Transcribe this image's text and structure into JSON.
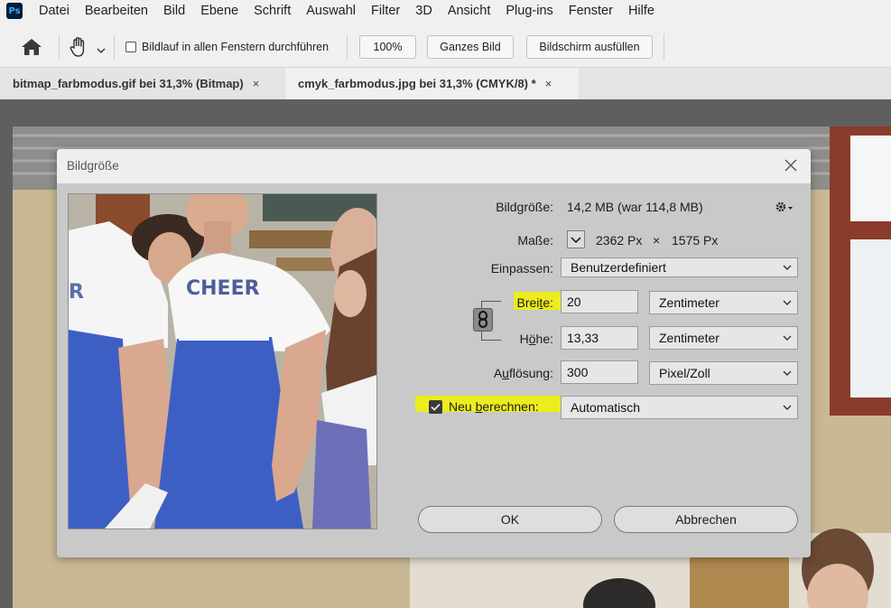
{
  "app": {
    "logo_text": "Ps"
  },
  "menu": [
    "Datei",
    "Bearbeiten",
    "Bild",
    "Ebene",
    "Schrift",
    "Auswahl",
    "Filter",
    "3D",
    "Ansicht",
    "Plug-ins",
    "Fenster",
    "Hilfe"
  ],
  "options": {
    "scroll_all_label": "Bildlauf in allen Fenstern durchführen",
    "zoom_100": "100%",
    "fit_screen": "Ganzes Bild",
    "fill_screen": "Bildschirm ausfüllen"
  },
  "tabs": [
    {
      "label": "bitmap_farbmodus.gif bei 31,3% (Bitmap)",
      "close": "×"
    },
    {
      "label": "cmyk_farbmodus.jpg bei 31,3% (CMYK/8) *",
      "close": "×"
    }
  ],
  "dialog": {
    "title": "Bildgröße",
    "image_size_label": "Bildgröße:",
    "image_size_value": "14,2 MB (war 114,8 MB)",
    "dimensions_label": "Maße:",
    "dimensions_width": "2362 Px",
    "dimensions_x": "×",
    "dimensions_height": "1575 Px",
    "fit_label": "Einpassen:",
    "fit_value": "Benutzerdefiniert",
    "width_label_pre": "Brei",
    "width_label_u": "t",
    "width_label_post": "e:",
    "width_value": "20",
    "width_unit": "Zentimeter",
    "height_label_pre": "H",
    "height_label_u": "ö",
    "height_label_post": "he:",
    "height_value": "13,33",
    "height_unit": "Zentimeter",
    "resolution_label_pre": "A",
    "resolution_label_u": "u",
    "resolution_label_post": "flösung:",
    "resolution_value": "300",
    "resolution_unit": "Pixel/Zoll",
    "resample_label_pre": "Neu ",
    "resample_label_u": "b",
    "resample_label_post": "erechnen:",
    "resample_checked": true,
    "resample_value": "Automatisch",
    "ok": "OK",
    "cancel": "Abbrechen"
  },
  "preview": {
    "shirt_text": "CHEER",
    "shirt_text_left": "R"
  },
  "colors": {
    "highlight": "#f2f200",
    "ps_bg": "#001e36",
    "ps_fg": "#31a8ff",
    "dress_blue": "#3d5fc4"
  }
}
